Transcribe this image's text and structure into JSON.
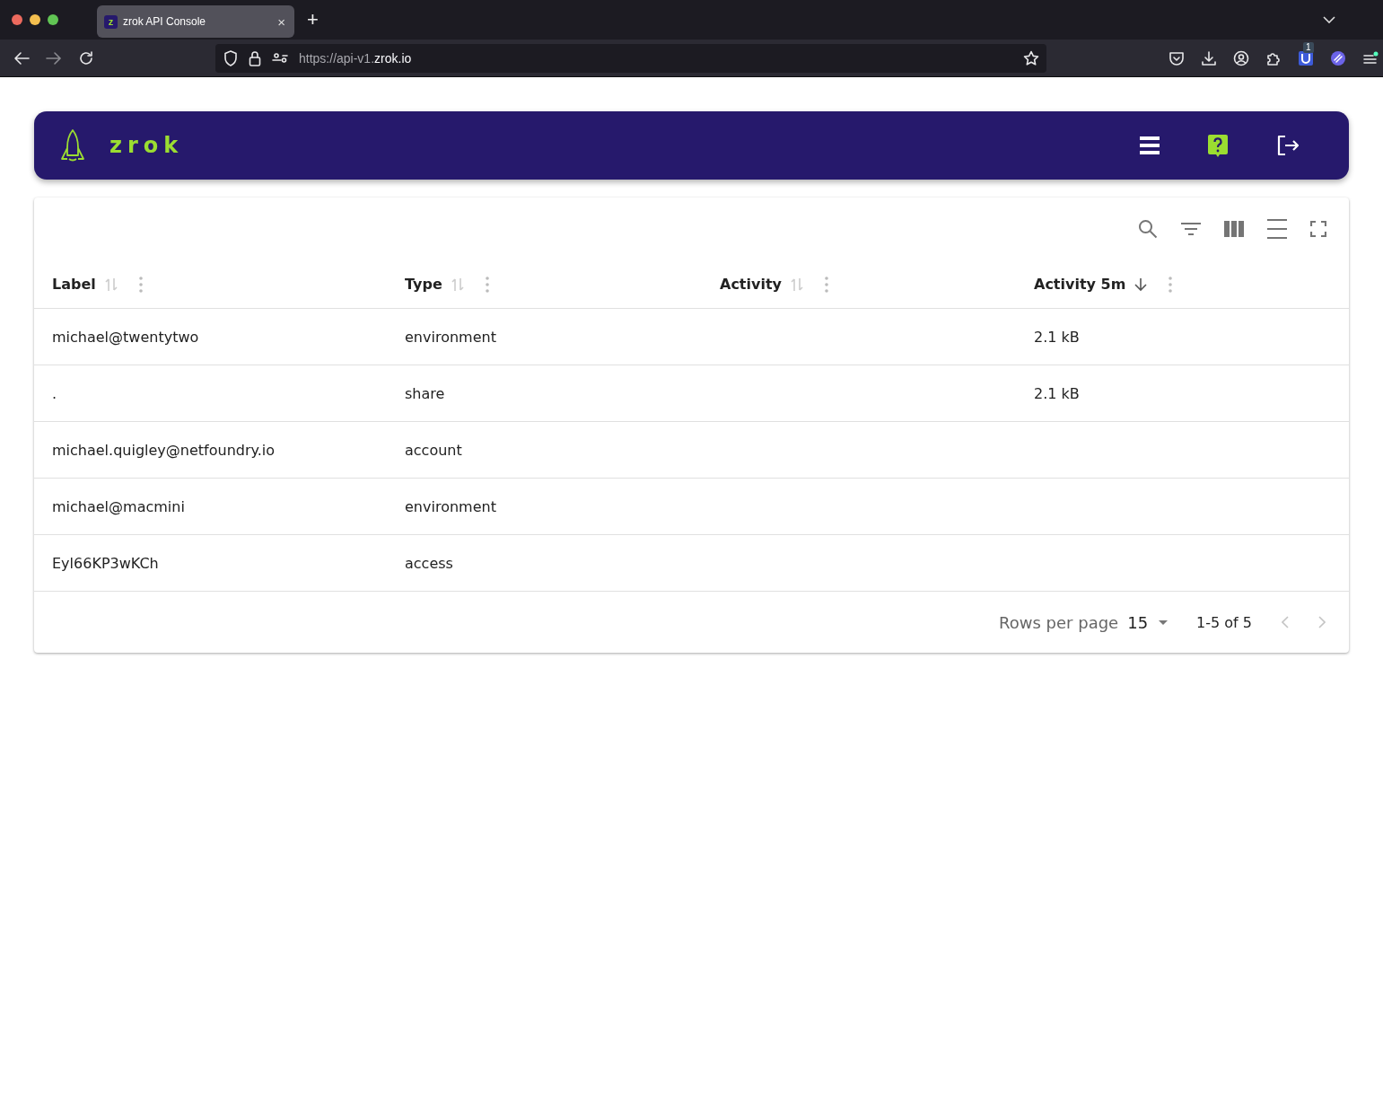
{
  "browser": {
    "tab": {
      "favicon_letter": "z",
      "title": "zrok API Console",
      "close": "×"
    },
    "new_tab": "+",
    "url_prefix": "https://api-v1.",
    "url_domain": "zrok.io",
    "extension_badge": "1"
  },
  "header": {
    "brand": "zrok"
  },
  "table": {
    "columns": [
      {
        "label": "Label",
        "sorted_descending": false
      },
      {
        "label": "Type",
        "sorted_descending": false
      },
      {
        "label": "Activity",
        "sorted_descending": false
      },
      {
        "label": "Activity 5m",
        "sorted_descending": true
      }
    ],
    "rows": [
      [
        "michael@twentytwo",
        "environment",
        "",
        "2.1 kB"
      ],
      [
        ".",
        "share",
        "",
        "2.1 kB"
      ],
      [
        "michael.quigley@netfoundry.io",
        "account",
        "",
        ""
      ],
      [
        "michael@macmini",
        "environment",
        "",
        ""
      ],
      [
        "Eyl66KP3wKCh",
        "access",
        "",
        ""
      ]
    ]
  },
  "pagination": {
    "rows_per_page_label": "Rows per page",
    "rows_per_page": "15",
    "range": "1-5 of 5",
    "prev_disabled": true,
    "next_disabled": true
  }
}
